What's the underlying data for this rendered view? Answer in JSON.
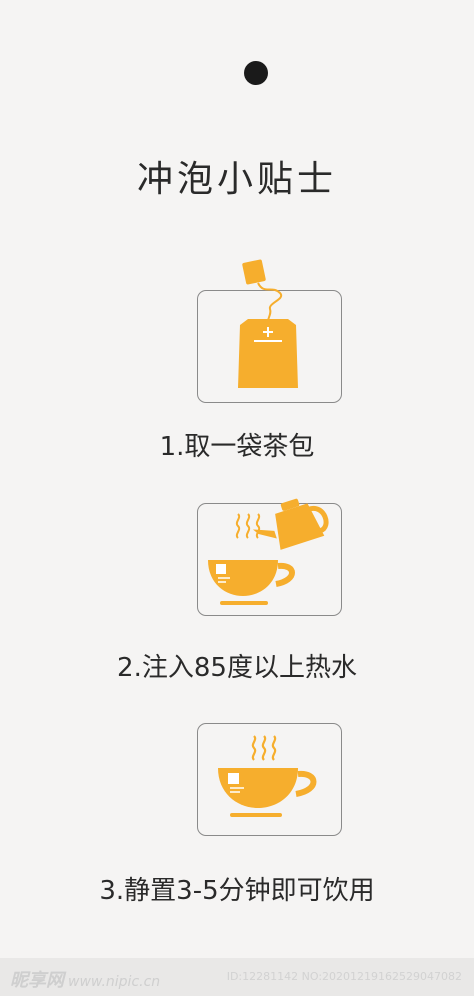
{
  "title": "冲泡小贴士",
  "steps": [
    {
      "label": "1.取一袋茶包",
      "icon": "tea-bag-icon"
    },
    {
      "label": "2.注入85度以上热水",
      "icon": "kettle-pour-cup-icon"
    },
    {
      "label": "3.静置3-5分钟即可饮用",
      "icon": "steaming-cup-icon"
    }
  ],
  "colors": {
    "accent": "#f6ae2d",
    "text": "#2a2a2a",
    "border": "#8a8a8a",
    "background": "#f5f4f3"
  },
  "watermark": {
    "brand": "昵享网",
    "site": "www.nipic.cn",
    "id": "ID:12281142 NO:20201219162529047082"
  }
}
